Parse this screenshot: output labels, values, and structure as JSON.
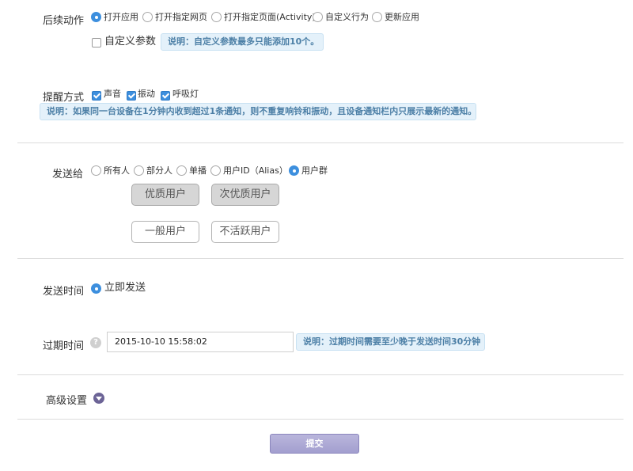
{
  "follow_action": {
    "label": "后续动作",
    "options": [
      "打开应用",
      "打开指定网页",
      "打开指定页面(Activity)",
      "自定义行为",
      "更新应用"
    ],
    "selected": "打开应用",
    "custom_params": {
      "label": "自定义参数",
      "checked": false,
      "note": "说明：自定义参数最多只能添加10个。"
    }
  },
  "alert_method": {
    "label": "提醒方式",
    "options": [
      {
        "label": "声音",
        "checked": true
      },
      {
        "label": "振动",
        "checked": true
      },
      {
        "label": "呼吸灯",
        "checked": true
      }
    ],
    "note": "说明：如果同一台设备在1分钟内收到超过1条通知，则不重复响铃和振动，且设备通知栏内只展示最新的通知。"
  },
  "send_to": {
    "label": "发送给",
    "options": [
      "所有人",
      "部分人",
      "单播",
      "用户ID（Alias）",
      "用户群"
    ],
    "selected": "用户群",
    "groups": [
      {
        "label": "优质用户",
        "selected": true
      },
      {
        "label": "次优质用户",
        "selected": true
      },
      {
        "label": "一般用户",
        "selected": false
      },
      {
        "label": "不活跃用户",
        "selected": false
      }
    ]
  },
  "send_time": {
    "label": "发送时间",
    "option": "立即发送",
    "selected": true
  },
  "expire_time": {
    "label": "过期时间",
    "help_icon": "question-icon",
    "help_glyph": "?",
    "value": "2015-10-10 15:58:02",
    "note": "说明：过期时间需要至少晚于发送时间30分钟"
  },
  "advanced": {
    "label": "高级设置",
    "toggle_icon": "chevron-down-icon"
  },
  "submit": {
    "label": "提交"
  },
  "colors": {
    "accent": "#3d8fde",
    "note_bg": "#e4f1fa",
    "note_text": "#4c7fa6",
    "submit_bg": "#a39fcf",
    "toggle": "#6c6496"
  }
}
